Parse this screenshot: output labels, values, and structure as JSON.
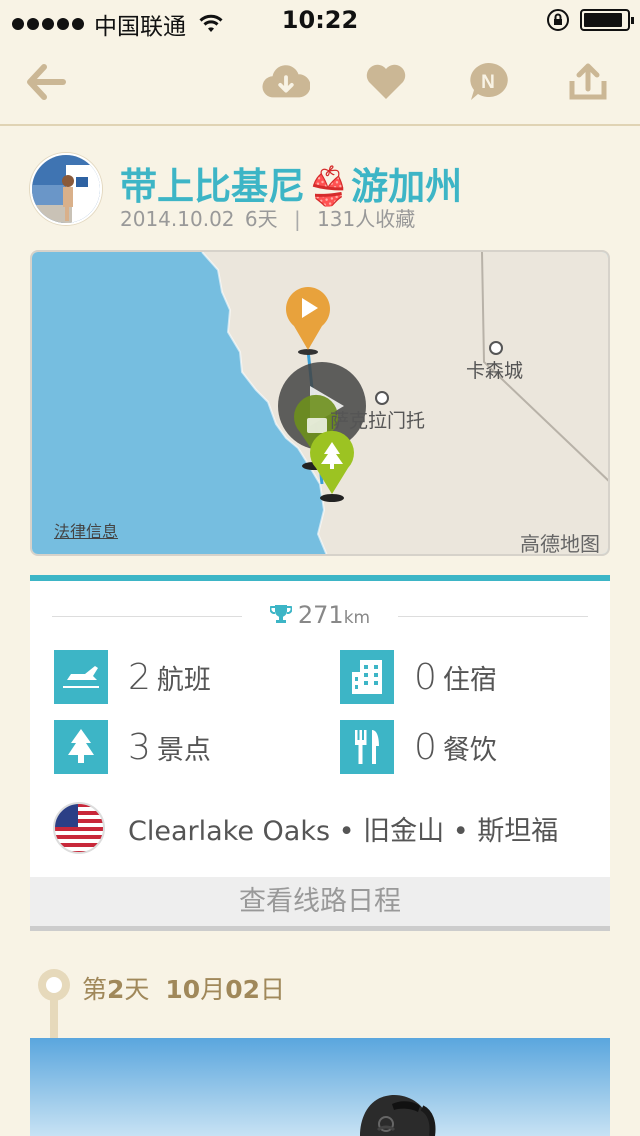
{
  "status_bar": {
    "carrier": "中国联通",
    "time": "10:22"
  },
  "trip": {
    "title": "带上比基尼👙游加州",
    "date": "2014.10.02",
    "days": "6天",
    "separator": "|",
    "favorites": "131人收藏"
  },
  "map": {
    "city_label_1": "卡森城",
    "city_label_2": "萨克拉门托",
    "legal_link": "法律信息",
    "provider": "高德地图"
  },
  "summary": {
    "distance_value": "271",
    "distance_unit": "km",
    "stats": [
      {
        "count": "2",
        "label": "航班",
        "icon": "plane-icon"
      },
      {
        "count": "0",
        "label": "住宿",
        "icon": "hotel-icon"
      },
      {
        "count": "3",
        "label": "景点",
        "icon": "tree-icon"
      },
      {
        "count": "0",
        "label": "餐饮",
        "icon": "food-icon"
      }
    ],
    "places": "Clearlake Oaks • 旧金山 • 斯坦福",
    "route_button": "查看线路日程"
  },
  "day": {
    "prefix": "第",
    "num": "2",
    "suffix": "天",
    "date_num1": "10",
    "month": "月",
    "date_num2": "02",
    "day_char": "日"
  },
  "colors": {
    "accent": "#3db5c6",
    "background": "#f8f3e5",
    "nav_icon": "#cbb795",
    "day_text": "#a0885a"
  }
}
